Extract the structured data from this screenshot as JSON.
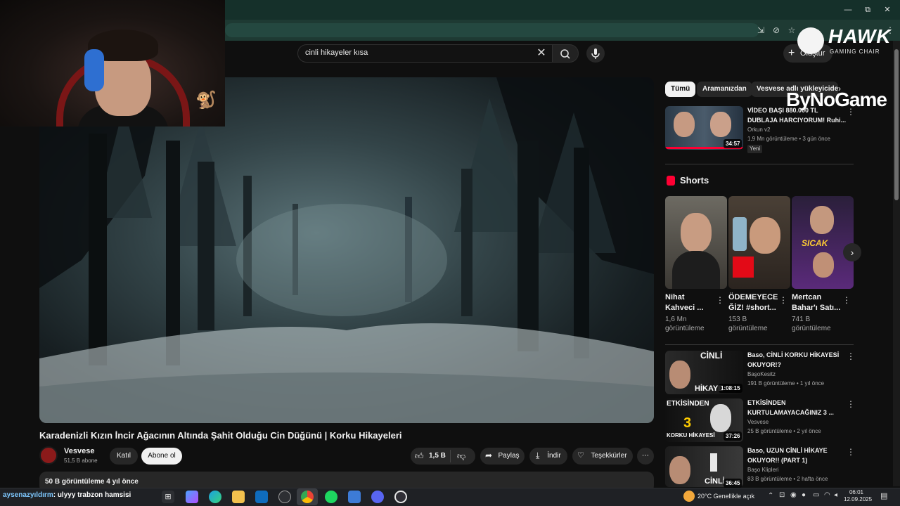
{
  "window": {
    "minimize": "—",
    "maximize": "⧉",
    "close": "✕"
  },
  "search": {
    "query": "cinli hikayeler kısa"
  },
  "header": {
    "create_label": "Oluştur"
  },
  "overlay": {
    "hawk_brand": "HAWK",
    "hawk_sub": "GAMING CHAIR",
    "sponsor": "ByNoGame"
  },
  "video": {
    "title": "Karadenizli Kızın İncir Ağacının Altında Şahit Olduğu Cin Düğünü | Korku Hikayeleri",
    "channel": "Vesvese",
    "subscribers": "51,5 B abone",
    "join_label": "Katıl",
    "subscribe_label": "Abone ol",
    "likes": "1,5 B",
    "share_label": "Paylaş",
    "download_label": "İndir",
    "thanks_label": "Teşekkürler",
    "views_date": "50 B görüntüleme  4 yıl önce"
  },
  "sidebar": {
    "chips": [
      "Tümü",
      "Aramanızdan",
      "Vesvese adlı yükleyiciden"
    ],
    "top_video": {
      "title_line1": "VİDEO BAŞI 880.000 TL",
      "title_line2": "DUBLAJA HARCIYORUM! Ruhi...",
      "channel": "Orkun v2",
      "meta": "1,9 Mn görüntüleme • 3 gün önce",
      "badge": "Yeni",
      "duration": "34:57"
    },
    "shorts_heading": "Shorts",
    "shorts": [
      {
        "title_line1": "Nihat",
        "title_line2": "Kahveci ...",
        "views_line1": "1,6 Mn",
        "views_line2": "görüntüleme",
        "caption": ""
      },
      {
        "title_line1": "ÖDEMEYECE",
        "title_line2": "ĞİZ! #short...",
        "views_line1": "153 B",
        "views_line2": "görüntüleme",
        "caption": ""
      },
      {
        "title_line1": "Mertcan",
        "title_line2": "Bahar'ı Satı...",
        "views_line1": "741 B",
        "views_line2": "görüntüleme",
        "caption": "SICAK"
      }
    ],
    "videos": [
      {
        "title_line1": "Baso, CİNLİ KORKU HİKAYESİ",
        "title_line2": "OKUYOR!?",
        "channel": "BaşoKesitz",
        "meta": "191 B görüntüleme • 1 yıl önce",
        "duration": "1:08:15",
        "thumb_text_top": "CİNLİ",
        "thumb_text_bottom": "HİKAYE"
      },
      {
        "title_line1": "ETKİSİNDEN",
        "title_line2": "KURTULAMAYACAĞINIZ 3 ...",
        "channel": "Vesvese",
        "meta": "25 B görüntüleme • 2 yıl önce",
        "duration": "37:26",
        "thumb_text_top": "ETKİSİNDEN",
        "thumb_text_bottom": "KORKU HİKAYESİ"
      },
      {
        "title_line1": "Baso, UZUN CİNLİ HİKAYE",
        "title_line2": "OKUYOR!! (PART 1)",
        "channel": "Başo Klipleri",
        "meta": "83 B görüntüleme • 2 hafta önce",
        "duration": "36:45",
        "thumb_text_top": "",
        "thumb_text_bottom": "CİNLİ"
      }
    ]
  },
  "taskbar": {
    "ticker_user": "aysenazyıldırm",
    "ticker_message": ": ulyyy trabzon hamsisi",
    "weather": "20°C  Genellikle açık",
    "time": "06:01",
    "date": "12.09.2025"
  },
  "colors": {
    "accent_red": "#ff0033",
    "bg": "#0f0f0f",
    "chrome": "#1e3a33"
  }
}
